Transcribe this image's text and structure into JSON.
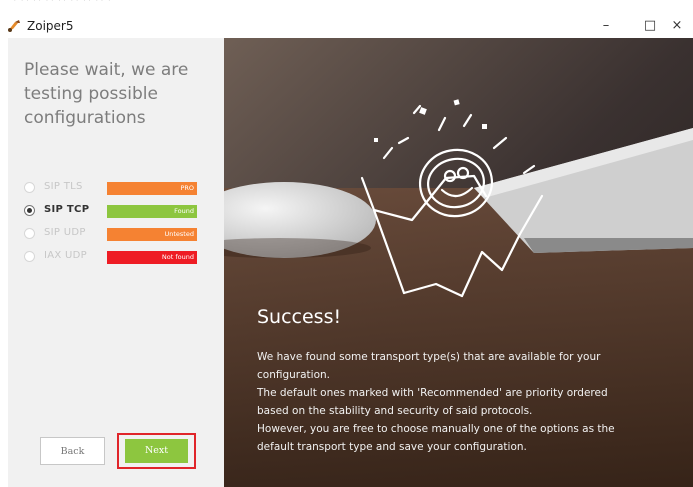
{
  "window": {
    "title": "Zoiper5",
    "controls": {
      "minimize": "–",
      "maximize": "□",
      "close": "×"
    }
  },
  "left": {
    "heading": "Please wait, we are testing possible configurations",
    "protocols": [
      {
        "name": "SIP TLS",
        "status": "PRO",
        "color": "#f58232",
        "selected": false
      },
      {
        "name": "SIP TCP",
        "status": "Found",
        "color": "#8dc63f",
        "selected": true
      },
      {
        "name": "SIP UDP",
        "status": "Untested",
        "color": "#f58232",
        "selected": false
      },
      {
        "name": "IAX UDP",
        "status": "Not found",
        "color": "#ee1c24",
        "selected": false
      }
    ],
    "back_label": "Back",
    "next_label": "Next"
  },
  "right": {
    "heading": "Success!",
    "description": "We have found some transport type(s) that are available for your configuration.\nThe default ones marked with 'Recommended' are priority ordered based on the stability and security of said protocols.\nHowever, you are free to choose manually one of the options as the default  transport type and save your configuration."
  },
  "colors": {
    "next_highlight": "#e0252a"
  }
}
